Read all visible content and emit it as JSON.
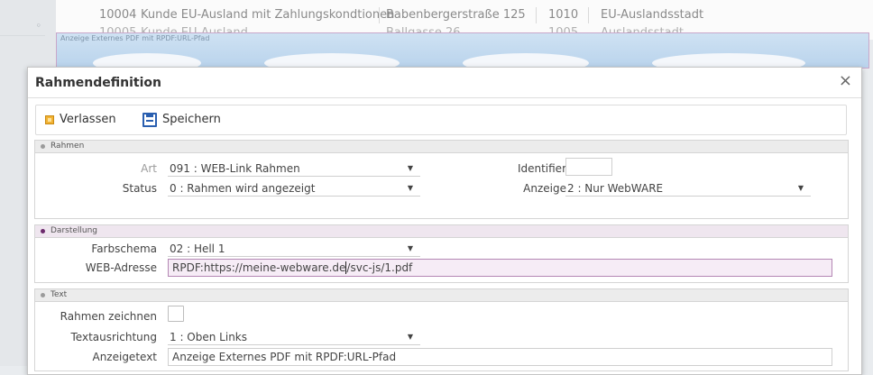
{
  "background": {
    "rows": [
      {
        "id": "10004",
        "name": "Kunde EU-Ausland mit Zahlungskondtionen",
        "street": "Babenbergerstraße 125",
        "zip": "1010",
        "city": "EU-Auslandsstadt"
      },
      {
        "id": "10005",
        "name": "Kunde EU-Ausland",
        "street": "Ballgasse 26",
        "zip": "1005",
        "city": "Auslandsstadt"
      }
    ],
    "frame_title": "Anzeige Externes PDF mit RPDF:URL-Pfad"
  },
  "modal": {
    "title": "Rahmendefinition",
    "close_icon": "×",
    "toolbar": {
      "exit_label": "Verlassen",
      "exit_icon": "exit-door-icon",
      "save_label": "Speichern",
      "save_icon": "floppy-disk-icon"
    },
    "sections": {
      "rahmen": {
        "title": "Rahmen",
        "art_label": "Art",
        "art_value": "091 : WEB-Link Rahmen",
        "status_label": "Status",
        "status_value": "0 : Rahmen wird angezeigt",
        "identifier_label": "Identifier",
        "identifier_value": "",
        "anzeige_label": "Anzeige",
        "anzeige_value": "2 : Nur WebWARE"
      },
      "darstellung": {
        "title": "Darstellung",
        "farbschema_label": "Farbschema",
        "farbschema_value": "02 : Hell 1",
        "webadresse_label": "WEB-Adresse",
        "webadresse_value_before_cursor": "RPDF:https://meine-webware.de",
        "webadresse_value_after_cursor": "/svc-js/1.pdf"
      },
      "text": {
        "title": "Text",
        "rahmen_zeichnen_label": "Rahmen zeichnen",
        "textausrichtung_label": "Textausrichtung",
        "textausrichtung_value": "1 : Oben Links",
        "anzeigetext_label": "Anzeigetext",
        "anzeigetext_value": "Anzeige Externes PDF mit RPDF:URL-Pfad"
      }
    },
    "colors": {
      "active_section": "#6c2a6c",
      "highlight_field": "#f6ecf6",
      "save_icon": "#2a5fb0",
      "exit_icon": "#f2b233"
    }
  }
}
